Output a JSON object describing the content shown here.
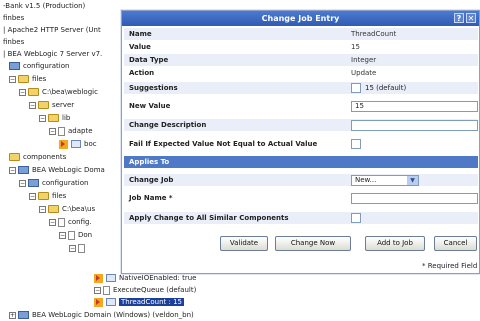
{
  "tree": {
    "rows": [
      {
        "text": "-Bank v1.5 (Production)"
      },
      {
        "text": "finbes"
      },
      {
        "text": "| Apache2 HTTP Server (Unt"
      },
      {
        "text": "finbes"
      },
      {
        "text": "| BEA WebLogic 7 Server v7."
      },
      {
        "text": "configuration"
      },
      {
        "text": "files"
      },
      {
        "text": "C:\\bea\\weblogic"
      },
      {
        "text": "server"
      },
      {
        "text": "lib"
      },
      {
        "text": "adapte"
      },
      {
        "text": "boc"
      },
      {
        "text": "components"
      },
      {
        "text": "BEA WebLogic Doma"
      },
      {
        "text": "configuration"
      },
      {
        "text": "files"
      },
      {
        "text": "C:\\bea\\us"
      },
      {
        "text": "config."
      },
      {
        "text": "Don"
      },
      {
        "text": ""
      },
      {
        "text": "NativeIOEnabled: true"
      },
      {
        "text": "ExecuteQueue (default)"
      },
      {
        "text": "ThreadCount : 15"
      },
      {
        "text": "BEA WebLogic Domain (Windows) (veldon_bn)"
      }
    ]
  },
  "dialog": {
    "title": "Change Job Entry",
    "help_icon": "?",
    "close_icon": "✕",
    "fields": {
      "name_label": "Name",
      "name_value": "ThreadCount",
      "value_label": "Value",
      "value_value": "15",
      "datatype_label": "Data Type",
      "datatype_value": "Integer",
      "action_label": "Action",
      "action_value": "Update",
      "suggestions_label": "Suggestions",
      "suggestions_value": "15 (default)",
      "newvalue_label": "New Value",
      "newvalue_value": "15",
      "changedesc_label": "Change Description",
      "changedesc_value": "",
      "failif_label": "Fail If Expected Value Not Equal to Actual Value"
    },
    "applies_to": {
      "section_label": "Applies To",
      "changejob_label": "Change Job",
      "changejob_value": "New...",
      "jobname_label": "Job Name *",
      "jobname_value": "",
      "applyall_label": "Apply Change to All Similar Components"
    },
    "buttons": {
      "validate": "Validate",
      "change_now": "Change Now",
      "add_to_job": "Add to Job",
      "cancel": "Cancel"
    },
    "required_note": "* Required Field"
  }
}
